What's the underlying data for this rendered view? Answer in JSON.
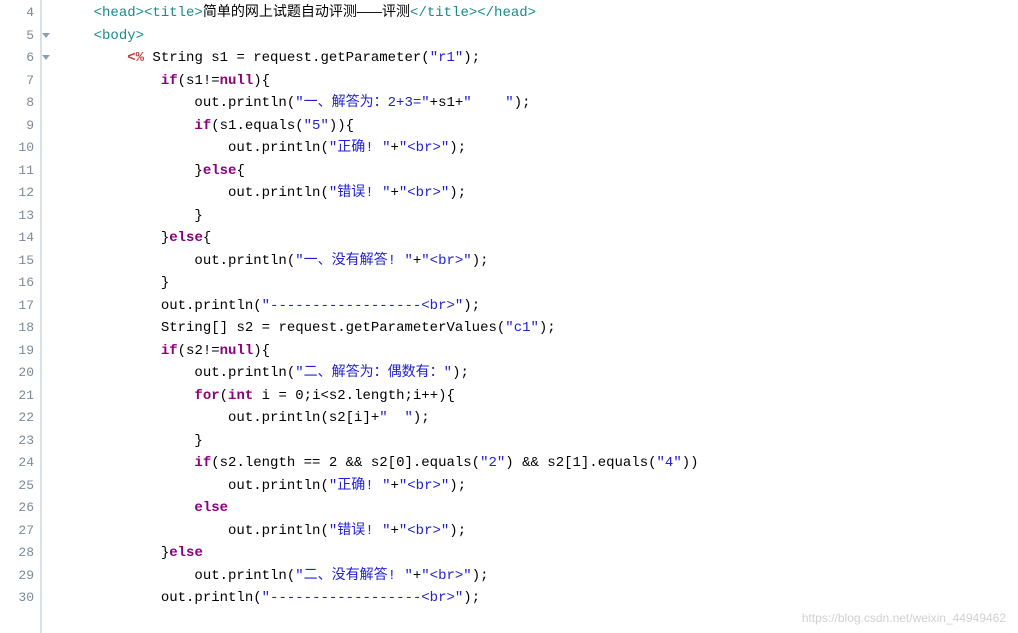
{
  "watermark": "https://blog.csdn.net/weixin_44949462",
  "firstLineNumber": 4,
  "lines": [
    {
      "indent": 1,
      "folded": false,
      "tokens": [
        {
          "t": "tag",
          "v": "<head><title>"
        },
        {
          "t": "txt",
          "v": "简单的网上试题自动评测———评测"
        },
        {
          "t": "tag",
          "v": "</title></head>"
        }
      ]
    },
    {
      "indent": 1,
      "folded": true,
      "tokens": [
        {
          "t": "tag",
          "v": "<body>"
        }
      ]
    },
    {
      "indent": 2,
      "folded": true,
      "tokens": [
        {
          "t": "scriptlet",
          "v": "<%"
        },
        {
          "t": "txt",
          "v": " String s1 = request.getParameter("
        },
        {
          "t": "str",
          "v": "\"r1\""
        },
        {
          "t": "txt",
          "v": ");"
        }
      ]
    },
    {
      "indent": 3,
      "tokens": [
        {
          "t": "kw",
          "v": "if"
        },
        {
          "t": "txt",
          "v": "(s1!="
        },
        {
          "t": "kw",
          "v": "null"
        },
        {
          "t": "txt",
          "v": "){"
        }
      ]
    },
    {
      "indent": 4,
      "tokens": [
        {
          "t": "txt",
          "v": "out.println("
        },
        {
          "t": "str",
          "v": "\"一、解答为：2+3=\""
        },
        {
          "t": "txt",
          "v": "+s1+"
        },
        {
          "t": "str",
          "v": "\"    \""
        },
        {
          "t": "txt",
          "v": ");"
        }
      ]
    },
    {
      "indent": 4,
      "tokens": [
        {
          "t": "kw",
          "v": "if"
        },
        {
          "t": "txt",
          "v": "(s1.equals("
        },
        {
          "t": "str",
          "v": "\"5\""
        },
        {
          "t": "txt",
          "v": ")){"
        }
      ]
    },
    {
      "indent": 5,
      "tokens": [
        {
          "t": "txt",
          "v": "out.println("
        },
        {
          "t": "str",
          "v": "\"正确! \""
        },
        {
          "t": "txt",
          "v": "+"
        },
        {
          "t": "str",
          "v": "\"<br>\""
        },
        {
          "t": "txt",
          "v": ");"
        }
      ]
    },
    {
      "indent": 4,
      "tokens": [
        {
          "t": "txt",
          "v": "}"
        },
        {
          "t": "kw",
          "v": "else"
        },
        {
          "t": "txt",
          "v": "{"
        }
      ]
    },
    {
      "indent": 5,
      "tokens": [
        {
          "t": "txt",
          "v": "out.println("
        },
        {
          "t": "str",
          "v": "\"错误! \""
        },
        {
          "t": "txt",
          "v": "+"
        },
        {
          "t": "str",
          "v": "\"<br>\""
        },
        {
          "t": "txt",
          "v": ");"
        }
      ]
    },
    {
      "indent": 4,
      "tokens": [
        {
          "t": "txt",
          "v": "}"
        }
      ]
    },
    {
      "indent": 3,
      "tokens": [
        {
          "t": "txt",
          "v": "}"
        },
        {
          "t": "kw",
          "v": "else"
        },
        {
          "t": "txt",
          "v": "{"
        }
      ]
    },
    {
      "indent": 4,
      "tokens": [
        {
          "t": "txt",
          "v": "out.println("
        },
        {
          "t": "str",
          "v": "\"一、没有解答! \""
        },
        {
          "t": "txt",
          "v": "+"
        },
        {
          "t": "str",
          "v": "\"<br>\""
        },
        {
          "t": "txt",
          "v": ");"
        }
      ]
    },
    {
      "indent": 3,
      "tokens": [
        {
          "t": "txt",
          "v": "}"
        }
      ]
    },
    {
      "indent": 3,
      "tokens": [
        {
          "t": "txt",
          "v": "out.println("
        },
        {
          "t": "str",
          "v": "\"------------------<br>\""
        },
        {
          "t": "txt",
          "v": ");"
        }
      ]
    },
    {
      "indent": 3,
      "tokens": [
        {
          "t": "txt",
          "v": "String[] s2 = request.getParameterValues("
        },
        {
          "t": "str",
          "v": "\"c1\""
        },
        {
          "t": "txt",
          "v": ");"
        }
      ]
    },
    {
      "indent": 3,
      "tokens": [
        {
          "t": "kw",
          "v": "if"
        },
        {
          "t": "txt",
          "v": "(s2!="
        },
        {
          "t": "kw",
          "v": "null"
        },
        {
          "t": "txt",
          "v": "){"
        }
      ]
    },
    {
      "indent": 4,
      "tokens": [
        {
          "t": "txt",
          "v": "out.println("
        },
        {
          "t": "str",
          "v": "\"二、解答为：偶数有：\""
        },
        {
          "t": "txt",
          "v": ");"
        }
      ]
    },
    {
      "indent": 4,
      "tokens": [
        {
          "t": "kw",
          "v": "for"
        },
        {
          "t": "txt",
          "v": "("
        },
        {
          "t": "ptype",
          "v": "int"
        },
        {
          "t": "txt",
          "v": " i = 0;i<s2.length;i++){"
        }
      ]
    },
    {
      "indent": 5,
      "tokens": [
        {
          "t": "txt",
          "v": "out.println(s2[i]+"
        },
        {
          "t": "str",
          "v": "\"  \""
        },
        {
          "t": "txt",
          "v": ");"
        }
      ]
    },
    {
      "indent": 4,
      "tokens": [
        {
          "t": "txt",
          "v": "}"
        }
      ]
    },
    {
      "indent": 4,
      "tokens": [
        {
          "t": "kw",
          "v": "if"
        },
        {
          "t": "txt",
          "v": "(s2.length == 2 && s2[0].equals("
        },
        {
          "t": "str",
          "v": "\"2\""
        },
        {
          "t": "txt",
          "v": ") && s2[1].equals("
        },
        {
          "t": "str",
          "v": "\"4\""
        },
        {
          "t": "txt",
          "v": "))"
        }
      ]
    },
    {
      "indent": 5,
      "tokens": [
        {
          "t": "txt",
          "v": "out.println("
        },
        {
          "t": "str",
          "v": "\"正确! \""
        },
        {
          "t": "txt",
          "v": "+"
        },
        {
          "t": "str",
          "v": "\"<br>\""
        },
        {
          "t": "txt",
          "v": ");"
        }
      ]
    },
    {
      "indent": 4,
      "tokens": [
        {
          "t": "kw",
          "v": "else"
        }
      ]
    },
    {
      "indent": 5,
      "tokens": [
        {
          "t": "txt",
          "v": "out.println("
        },
        {
          "t": "str",
          "v": "\"错误! \""
        },
        {
          "t": "txt",
          "v": "+"
        },
        {
          "t": "str",
          "v": "\"<br>\""
        },
        {
          "t": "txt",
          "v": ");"
        }
      ]
    },
    {
      "indent": 3,
      "tokens": [
        {
          "t": "txt",
          "v": "}"
        },
        {
          "t": "kw",
          "v": "else"
        }
      ]
    },
    {
      "indent": 4,
      "tokens": [
        {
          "t": "txt",
          "v": "out.println("
        },
        {
          "t": "str",
          "v": "\"二、没有解答! \""
        },
        {
          "t": "txt",
          "v": "+"
        },
        {
          "t": "str",
          "v": "\"<br>\""
        },
        {
          "t": "txt",
          "v": ");"
        }
      ]
    },
    {
      "indent": 3,
      "tokens": [
        {
          "t": "txt",
          "v": "out.println("
        },
        {
          "t": "str",
          "v": "\"------------------<br>\""
        },
        {
          "t": "txt",
          "v": ");"
        }
      ]
    }
  ]
}
